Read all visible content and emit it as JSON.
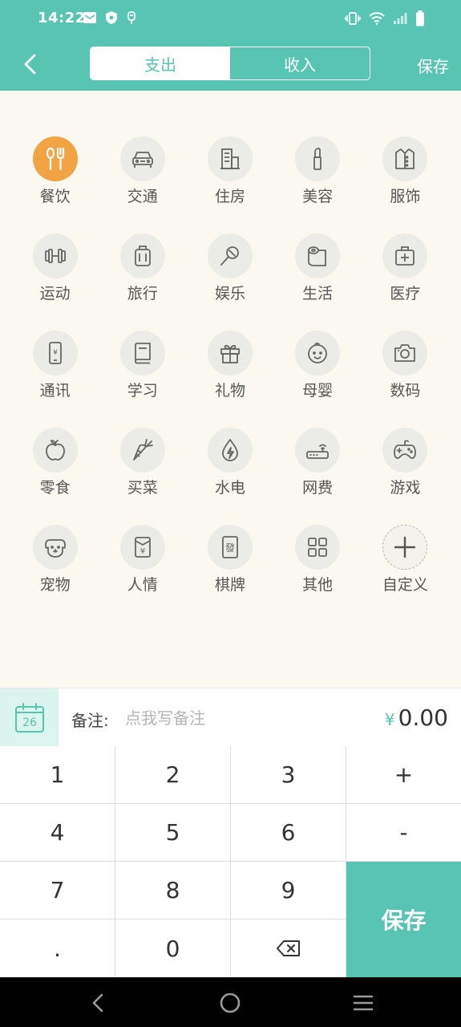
{
  "status": {
    "time": "14:22",
    "left_icons": [
      "mail-icon",
      "shield-icon",
      "usb-icon"
    ],
    "right_icons": [
      "vibrate-icon",
      "wifi-icon",
      "signal-icon",
      "battery-icon"
    ]
  },
  "header": {
    "tabs": [
      {
        "label": "支出",
        "active": true
      },
      {
        "label": "收入",
        "active": false
      }
    ],
    "save_label": "保存"
  },
  "categories": [
    {
      "label": "餐饮",
      "icon": "utensils-icon",
      "selected": true
    },
    {
      "label": "交通",
      "icon": "car-icon"
    },
    {
      "label": "住房",
      "icon": "building-icon"
    },
    {
      "label": "美容",
      "icon": "lipstick-icon"
    },
    {
      "label": "服饰",
      "icon": "shirt-icon"
    },
    {
      "label": "运动",
      "icon": "dumbbell-icon"
    },
    {
      "label": "旅行",
      "icon": "luggage-icon"
    },
    {
      "label": "娱乐",
      "icon": "microphone-icon"
    },
    {
      "label": "生活",
      "icon": "tissue-roll-icon"
    },
    {
      "label": "医疗",
      "icon": "medical-kit-icon"
    },
    {
      "label": "通讯",
      "icon": "phone-icon"
    },
    {
      "label": "学习",
      "icon": "book-icon"
    },
    {
      "label": "礼物",
      "icon": "gift-icon"
    },
    {
      "label": "母婴",
      "icon": "baby-icon"
    },
    {
      "label": "数码",
      "icon": "camera-icon"
    },
    {
      "label": "零食",
      "icon": "apple-icon"
    },
    {
      "label": "买菜",
      "icon": "carrot-icon"
    },
    {
      "label": "水电",
      "icon": "water-electric-icon"
    },
    {
      "label": "网费",
      "icon": "router-icon"
    },
    {
      "label": "游戏",
      "icon": "gamepad-icon"
    },
    {
      "label": "宠物",
      "icon": "dog-icon"
    },
    {
      "label": "人情",
      "icon": "red-envelope-icon"
    },
    {
      "label": "棋牌",
      "icon": "mahjong-icon"
    },
    {
      "label": "其他",
      "icon": "grid-icon"
    },
    {
      "label": "自定义",
      "icon": "plus-icon",
      "dashed": true
    }
  ],
  "note": {
    "date_day": "26",
    "label": "备注:",
    "placeholder": "点我写备注",
    "currency": "¥",
    "amount": "0.00"
  },
  "keypad": {
    "keys": [
      "1",
      "2",
      "3",
      "+",
      "4",
      "5",
      "6",
      "-",
      "7",
      "8",
      "9",
      ".",
      "0"
    ],
    "backspace_icon": "backspace-icon",
    "save_label": "保存"
  },
  "nav": {
    "icons": [
      "nav-back-icon",
      "nav-home-icon",
      "nav-menu-icon"
    ]
  },
  "colors": {
    "accent": "#57c5b1",
    "selected": "#f2a445",
    "background": "#fbf9ef"
  }
}
